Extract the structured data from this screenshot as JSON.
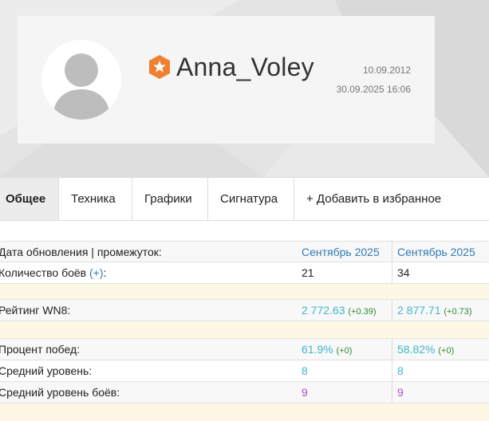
{
  "profile": {
    "username": "Anna_Voley",
    "created_date": "10.09.2012",
    "last_update": "30.09.2025 16:06",
    "badge_color": "#f0802f"
  },
  "tabs": [
    {
      "label": "Общее",
      "active": true
    },
    {
      "label": "Техника",
      "active": false
    },
    {
      "label": "Графики",
      "active": false
    },
    {
      "label": "Сигнатура",
      "active": false
    },
    {
      "label": "+ Добавить в избранное",
      "active": false
    }
  ],
  "stats": {
    "update_label": "Дата обновления | промежуток:",
    "period1": "Сентябрь 2025",
    "period2": "Сентябрь 2025",
    "battles_label": "Количество боёв",
    "battles_plus": "(+)",
    "battles_colon": ":",
    "battles1": "21",
    "battles2": "34",
    "wn8_label": "Рейтинг WN8:",
    "wn8_1": "2 772.63",
    "wn8_1_delta": "(+0.39)",
    "wn8_2": "2 877.71",
    "wn8_2_delta": "(+0.73)",
    "winrate_label": "Процент побед:",
    "winrate1": "61.9%",
    "winrate1_delta": "(+0)",
    "winrate2": "58.82%",
    "winrate2_delta": "(+0)",
    "avg_tier_label": "Средний уровень:",
    "avg_tier1": "8",
    "avg_tier2": "8",
    "avg_battle_tier_label": "Средний уровень боёв:",
    "avg_battle_tier1": "9",
    "avg_battle_tier2": "9"
  },
  "colors": {
    "link_blue": "#2d7ab5",
    "value_teal": "#3fb7c7",
    "value_purple": "#b048d8",
    "delta_green": "#2f8a2f",
    "spacer_yellow": "#fdf7e5"
  }
}
